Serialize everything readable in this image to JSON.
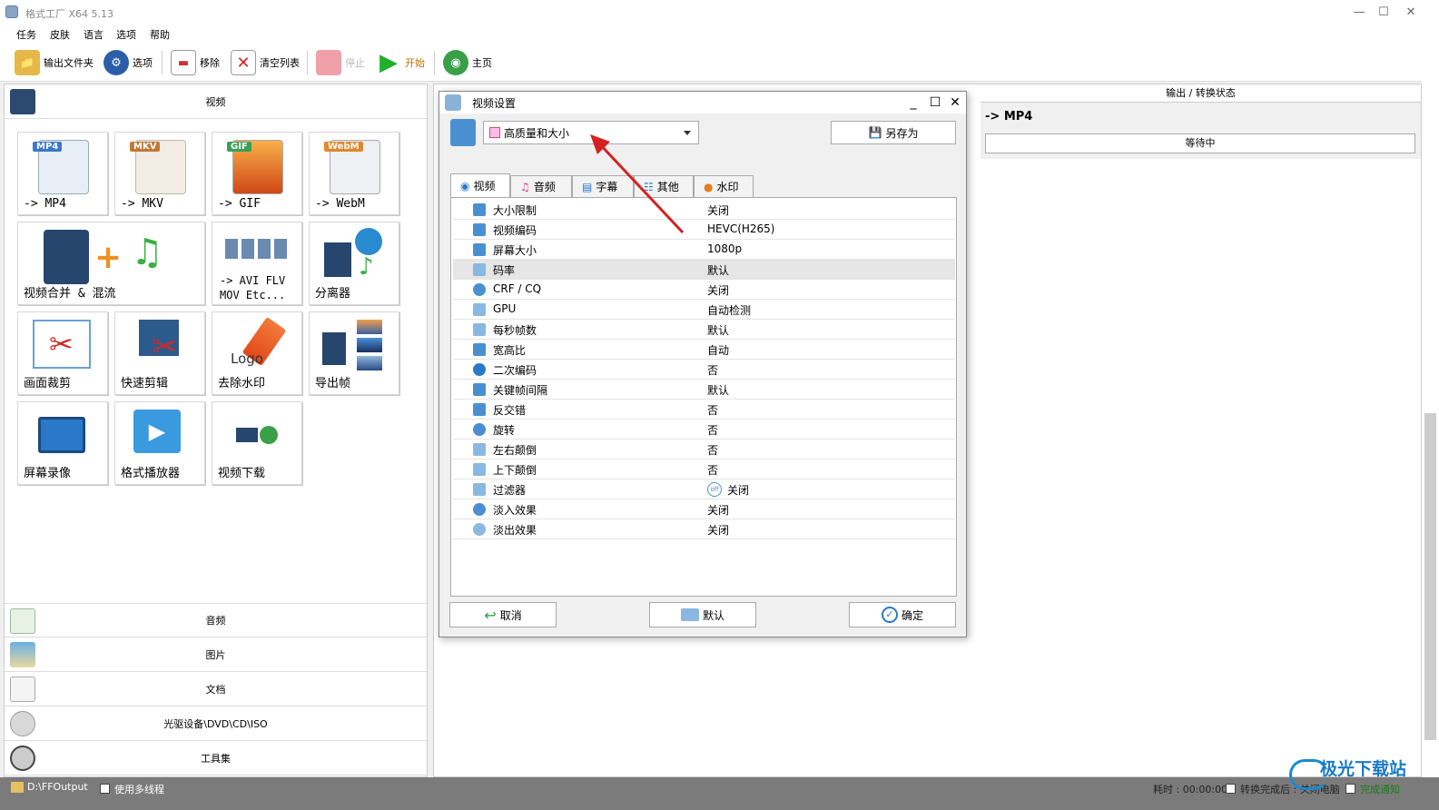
{
  "window": {
    "title": "格式工厂 X64 5.13"
  },
  "menu": [
    "任务",
    "皮肤",
    "语言",
    "选项",
    "帮助"
  ],
  "toolbar": {
    "output_folder": "输出文件夹",
    "options": "选项",
    "remove": "移除",
    "clear_list": "清空列表",
    "stop": "停止",
    "start": "开始",
    "home": "主页"
  },
  "left_panel": {
    "video_header": "视频",
    "tiles": [
      {
        "badge": "MP4",
        "label": "-> MP4",
        "color": "#3a78c8"
      },
      {
        "badge": "MKV",
        "label": "-> MKV",
        "color": "#c07838"
      },
      {
        "badge": "GIF",
        "label": "-> GIF",
        "color": "#3aa058"
      },
      {
        "badge": "WebM",
        "label": "-> WebM",
        "color": "#e08830"
      },
      {
        "label": "视频合并 & 混流"
      },
      {
        "label_line1": "-> AVI FLV",
        "label_line2": "MOV Etc..."
      },
      {
        "label": "分离器"
      },
      {
        "label": "画面裁剪"
      },
      {
        "label": "快速剪辑"
      },
      {
        "label": "去除水印",
        "logo_text": "Logo"
      },
      {
        "label": "导出帧"
      },
      {
        "label": "屏幕录像"
      },
      {
        "label": "格式播放器"
      },
      {
        "label": "视频下载"
      }
    ],
    "categories": [
      "音频",
      "图片",
      "文档",
      "光驱设备\\DVD\\CD\\ISO",
      "工具集"
    ]
  },
  "right_panel": {
    "status_header": "输出 / 转换状态",
    "output_format": "-> MP4",
    "status": "等待中"
  },
  "dialog": {
    "title": "视频设置",
    "preset": "高质量和大小",
    "save_as": "另存为",
    "tabs": [
      "视频",
      "音频",
      "字幕",
      "其他",
      "水印"
    ],
    "settings": [
      {
        "key": "大小限制",
        "value": "关闭"
      },
      {
        "key": "视频编码",
        "value": "HEVC(H265)"
      },
      {
        "key": "屏幕大小",
        "value": "1080p"
      },
      {
        "key": "码率",
        "value": "默认"
      },
      {
        "key": "CRF / CQ",
        "value": "关闭"
      },
      {
        "key": "GPU",
        "value": "自动检测"
      },
      {
        "key": "每秒帧数",
        "value": "默认"
      },
      {
        "key": "宽高比",
        "value": "自动"
      },
      {
        "key": "二次编码",
        "value": "否"
      },
      {
        "key": "关键帧间隔",
        "value": "默认"
      },
      {
        "key": "反交错",
        "value": "否"
      },
      {
        "key": "旋转",
        "value": "否"
      },
      {
        "key": "左右颠倒",
        "value": "否"
      },
      {
        "key": "上下颠倒",
        "value": "否"
      },
      {
        "key": "过滤器",
        "value": "关闭",
        "badge": "off"
      },
      {
        "key": "淡入效果",
        "value": "关闭"
      },
      {
        "key": "淡出效果",
        "value": "关闭"
      }
    ],
    "cancel": "取消",
    "default": "默认",
    "ok": "确定"
  },
  "footer": {
    "output_path": "D:\\FFOutput",
    "multithread": "使用多线程",
    "elapsed": "耗时 : 00:00:00",
    "after_convert": "转换完成后 : 关闭电脑",
    "notify": "完成通知"
  },
  "watermark": {
    "text": "极光下载站"
  }
}
